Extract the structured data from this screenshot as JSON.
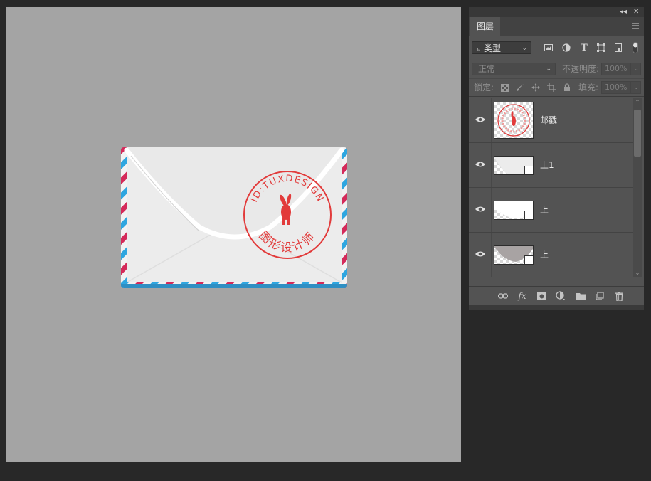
{
  "panel": {
    "tab_label": "图层",
    "topbar": {
      "collapse": "◂◂",
      "close": "✕"
    },
    "filter": {
      "kind_label": "类型"
    },
    "blend": {
      "mode": "正常",
      "opacity_label": "不透明度:",
      "opacity_value": "100%"
    },
    "lock": {
      "label": "锁定:",
      "fill_label": "填充:",
      "fill_value": "100%"
    },
    "layers": [
      {
        "name": "邮戳",
        "visible": true,
        "thumb": "stamp"
      },
      {
        "name": "上1",
        "visible": true,
        "thumb": "shape-light"
      },
      {
        "name": "上",
        "visible": true,
        "thumb": "shape-white"
      },
      {
        "name": "上",
        "visible": true,
        "thumb": "shape-gray"
      }
    ],
    "bottom_icons": [
      "link-icon",
      "fx-icon",
      "mask-icon",
      "adjustment-icon",
      "folder-icon",
      "new-layer-icon",
      "trash-icon"
    ]
  },
  "canvas": {
    "background": "#a4a4a4",
    "stamp": {
      "top_text": "ID:TUXDESIGN",
      "bottom_text": "图形设计师",
      "color": "#e23b3b"
    },
    "stripe_colors": {
      "red": "#d42a5a",
      "blue": "#2ea6e0"
    }
  }
}
